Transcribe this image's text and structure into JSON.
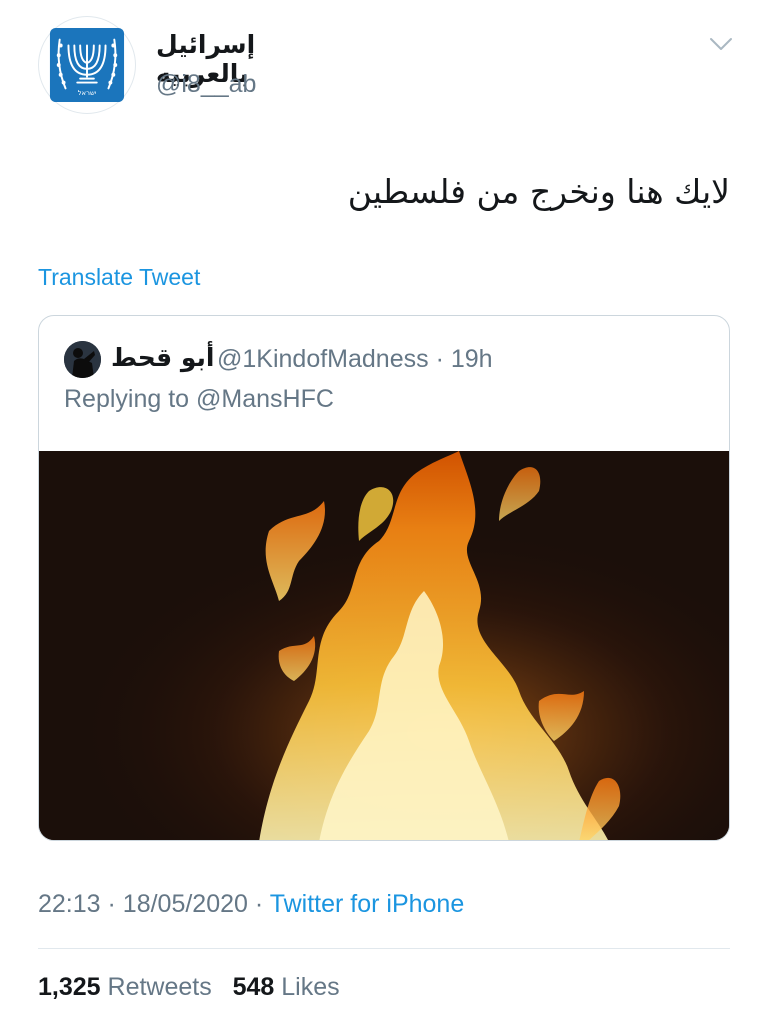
{
  "tweet": {
    "author": {
      "display_name": "إسرائيل بالعربيه",
      "handle": "@i8__ab",
      "avatar_icon": "menorah-emblem-icon",
      "emblem_text": "ישראל"
    },
    "menu_icon": "chevron-down-icon",
    "text": "لايك هنا ونخرج من فلسطين",
    "translate_label": "Translate Tweet",
    "quoted": {
      "display_name": "أبو قحط",
      "handle": "@1KindofMadness",
      "separator": "·",
      "time": "19h",
      "replying_prefix": "Replying to",
      "replying_to": "@MansHFC",
      "image_icon": "fire-photo"
    },
    "time": "22:13",
    "date": "18/05/2020",
    "separator": "·",
    "source": "Twitter for iPhone",
    "stats": {
      "retweets_count": "1,325",
      "retweets_label": "Retweets",
      "likes_count": "548",
      "likes_label": "Likes"
    },
    "colors": {
      "link": "#1b95e0",
      "muted": "#657786",
      "text": "#14171a",
      "border": "#ccd6dd",
      "emblem_blue": "#1b75bc"
    }
  }
}
